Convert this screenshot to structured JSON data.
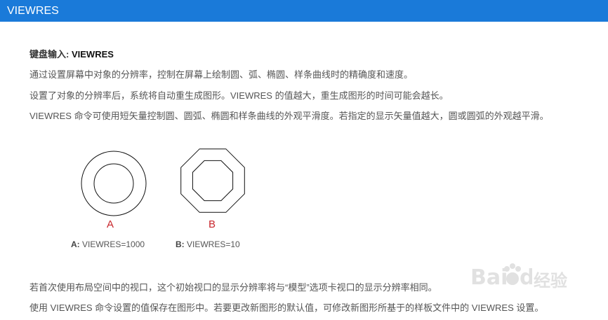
{
  "header": {
    "title": "VIEWRES"
  },
  "content": {
    "keyboard_label": "键盘输入:",
    "keyboard_value": "VIEWRES",
    "paragraph_1": "通过设置屏幕中对象的分辨率，控制在屏幕上绘制圆、弧、椭圆、样条曲线时的精确度和速度。",
    "paragraph_2": "设置了对象的分辨率后，系统将自动重生成图形。VIEWRES 的值越大，重生成图形的时间可能会越长。",
    "paragraph_3": "VIEWRES 命令可使用短矢量控制圆、圆弧、椭圆和样条曲线的外观平滑度。若指定的显示矢量值越大，圆或圆弧的外观越平滑。",
    "paragraph_4": "若首次使用布局空间中的视口，这个初始视口的显示分辨率将与“模型”选项卡视口的显示分辨率相同。",
    "paragraph_5": "使用 VIEWRES 命令设置的值保存在图形中。若要更改新图形的默认值，可修改新图形所基于的样板文件中的 VIEWRES 设置。"
  },
  "figure": {
    "a": {
      "letter": "A",
      "caption_label": "A:",
      "caption_value": "VIEWRES=1000"
    },
    "b": {
      "letter": "B",
      "caption_label": "B:",
      "caption_value": "VIEWRES=10"
    }
  },
  "watermark": {
    "text": "经验"
  },
  "colors": {
    "header_bg": "#1a7ad9",
    "caption_letter": "#c8262c",
    "body_text": "#555555"
  }
}
